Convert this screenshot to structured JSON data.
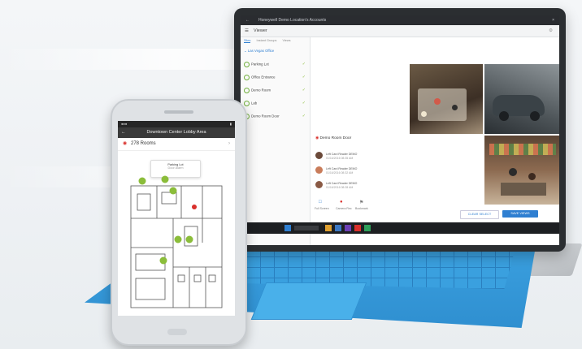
{
  "tablet": {
    "window_title": "Honeywell Demo Location's Accounts",
    "app_header": "Viewer",
    "sidebar_tabs": [
      "Sites",
      "Instant Groups",
      "Views"
    ],
    "site_group": "Las Vegas Office",
    "site_items": [
      "Parking Lot",
      "Office Entrance",
      "Demo Room",
      "Lab",
      "Demo Room Door"
    ],
    "detail_title": "Demo Room Door",
    "events": [
      {
        "label": "Left Card Reader DEMO",
        "time": "01/16/2016 08:35 AM"
      },
      {
        "label": "Left Card Reader DEMO",
        "time": "01/16/2016 08:32 AM"
      },
      {
        "label": "Left Card Reader DEMO",
        "time": "01/16/2016 08:28 AM"
      }
    ],
    "nav_labels": [
      "Full Screen",
      "Camera Rec",
      "Bookmark"
    ],
    "clear_button": "CLEAR SELECT",
    "save_button": "SAVE VIEWS"
  },
  "phone": {
    "title": "Downtown Center Lobby Area",
    "header": "278 Rooms",
    "tooltip_title": "Parking Lot",
    "tooltip_sub": "Door Alarm"
  },
  "colors": {
    "keyboard": "#3aa0df",
    "accent_green": "#8bbd3a",
    "alert_red": "#d9302c",
    "button_blue": "#2f7fd1"
  }
}
